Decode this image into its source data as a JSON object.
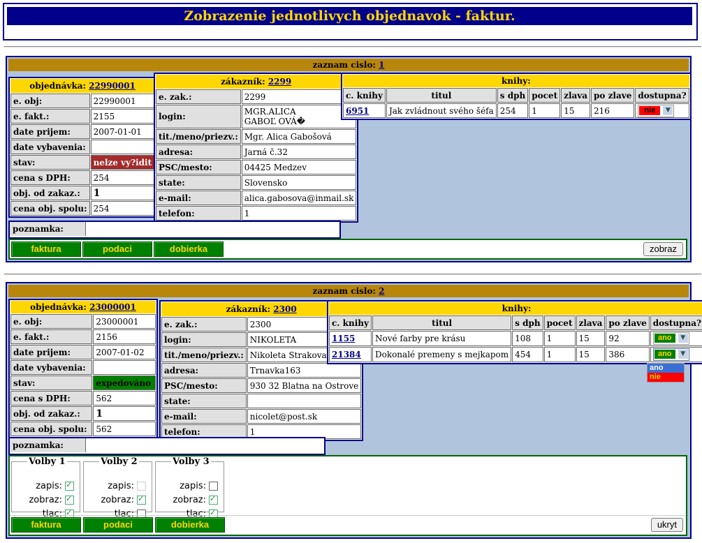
{
  "page_title": "Zobrazenie jednotlivych objednavok - faktur.",
  "labels": {
    "zaznam": "zaznam cislo:",
    "objednavka": "objednávka:",
    "zakaznik": "zákazník:",
    "knihy": "knihy:",
    "poznamka": "poznamka:"
  },
  "order_fields": [
    "e. obj:",
    "e. fakt.:",
    "date prijem:",
    "date vybavenia:",
    "stav:",
    "cena s DPH:",
    "obj. od zakaz.:",
    "cena obj. spolu:"
  ],
  "customer_fields": [
    "e. zak.:",
    "login:",
    "tit./meno/priezv.:",
    "adresa:",
    "PSC/mesto:",
    "state:",
    "e-mail:",
    "telefon:"
  ],
  "book_columns": [
    "c. knihy",
    "titul",
    "s dph",
    "pocet",
    "zlava",
    "po zlave",
    "dostupna?"
  ],
  "buttons": {
    "faktura": "faktura",
    "podaci": "podaci",
    "dobierka": "dobierka"
  },
  "records": [
    {
      "number": "1",
      "order": {
        "id": "22990001",
        "e_obj": "22990001",
        "e_fakt": "2155",
        "date_prijem": "2007-01-01",
        "date_vybavenia": "",
        "stav": "nelze vy?idit",
        "cena_dph": "254",
        "obj_od_zakaz": "1",
        "cena_spolu": "254"
      },
      "customer": {
        "id": "2299",
        "e_zak": "2299",
        "login_1": "MGR.ALICA",
        "login_2": "GABOĽ OVÁ�",
        "name": "Mgr. Alica Gabošová",
        "adresa": "Jarná č.32",
        "psc": "04425 Medzev",
        "state": "Slovensko",
        "email": "alica.gabosova@inmail.sk",
        "telefon": "1"
      },
      "books": [
        {
          "id": "6951",
          "titul": "Jak zvládnout svého šéfa",
          "s_dph": "254",
          "pocet": "1",
          "zlava": "15",
          "po_zlave": "216",
          "dostupna": "nie"
        }
      ],
      "poznamka": "",
      "action_button": "zobraz"
    },
    {
      "number": "2",
      "order": {
        "id": "23000001",
        "e_obj": "23000001",
        "e_fakt": "2156",
        "date_prijem": "2007-01-02",
        "date_vybavenia": "",
        "stav": "expedováno",
        "cena_dph": "562",
        "obj_od_zakaz": "1",
        "cena_spolu": "562"
      },
      "customer": {
        "id": "2300",
        "e_zak": "2300",
        "login_1": "NIKOLETA",
        "name": "Nikoleta Strakova",
        "adresa": "Trnavka163",
        "psc": "930 32 Blatna na Ostrove",
        "state": "",
        "email": "nicolet@post.sk",
        "telefon": "1"
      },
      "books": [
        {
          "id": "1155",
          "titul": "Nové farby pre krásu",
          "s_dph": "108",
          "pocet": "1",
          "zlava": "15",
          "po_zlave": "92",
          "dostupna": "ano"
        },
        {
          "id": "21384",
          "titul": "Dokonalé premeny s mejkapom",
          "s_dph": "454",
          "pocet": "1",
          "zlava": "15",
          "po_zlave": "386",
          "dostupna": "ano"
        }
      ],
      "dropdown_options": [
        "ano",
        "nie"
      ],
      "poznamka": "",
      "volby": [
        {
          "title": "Volby 1",
          "zapis_label": "zapis:",
          "zobraz_label": "zobraz:",
          "tlac_label": "tlac:",
          "zapis": "checked",
          "zobraz": "checked",
          "tlac": "checked"
        },
        {
          "title": "Volby 2",
          "zapis_label": "zapis:",
          "zobraz_label": "zobraz:",
          "tlac_label": "tlac:",
          "zapis": "disabled",
          "zobraz": "checked",
          "tlac": "unchecked"
        },
        {
          "title": "Volby 3",
          "zapis_label": "zapis:",
          "zobraz_label": "zobraz:",
          "tlac_label": "tlac:",
          "zapis": "unchecked",
          "zobraz": "checked",
          "tlac": "checked"
        }
      ],
      "action_button": "ukryt"
    }
  ],
  "colors": {
    "header_bg": "#00008b",
    "header_text": "#ffd700",
    "record_bg": "#b0c4de",
    "bar_bg": "#b8860b",
    "table_head": "#ffd700",
    "status_error": "#a52a2a",
    "status_ok": "#008000",
    "nie_bg": "#ff0000",
    "ano_bg": "#008000",
    "button_bg": "#008000"
  }
}
